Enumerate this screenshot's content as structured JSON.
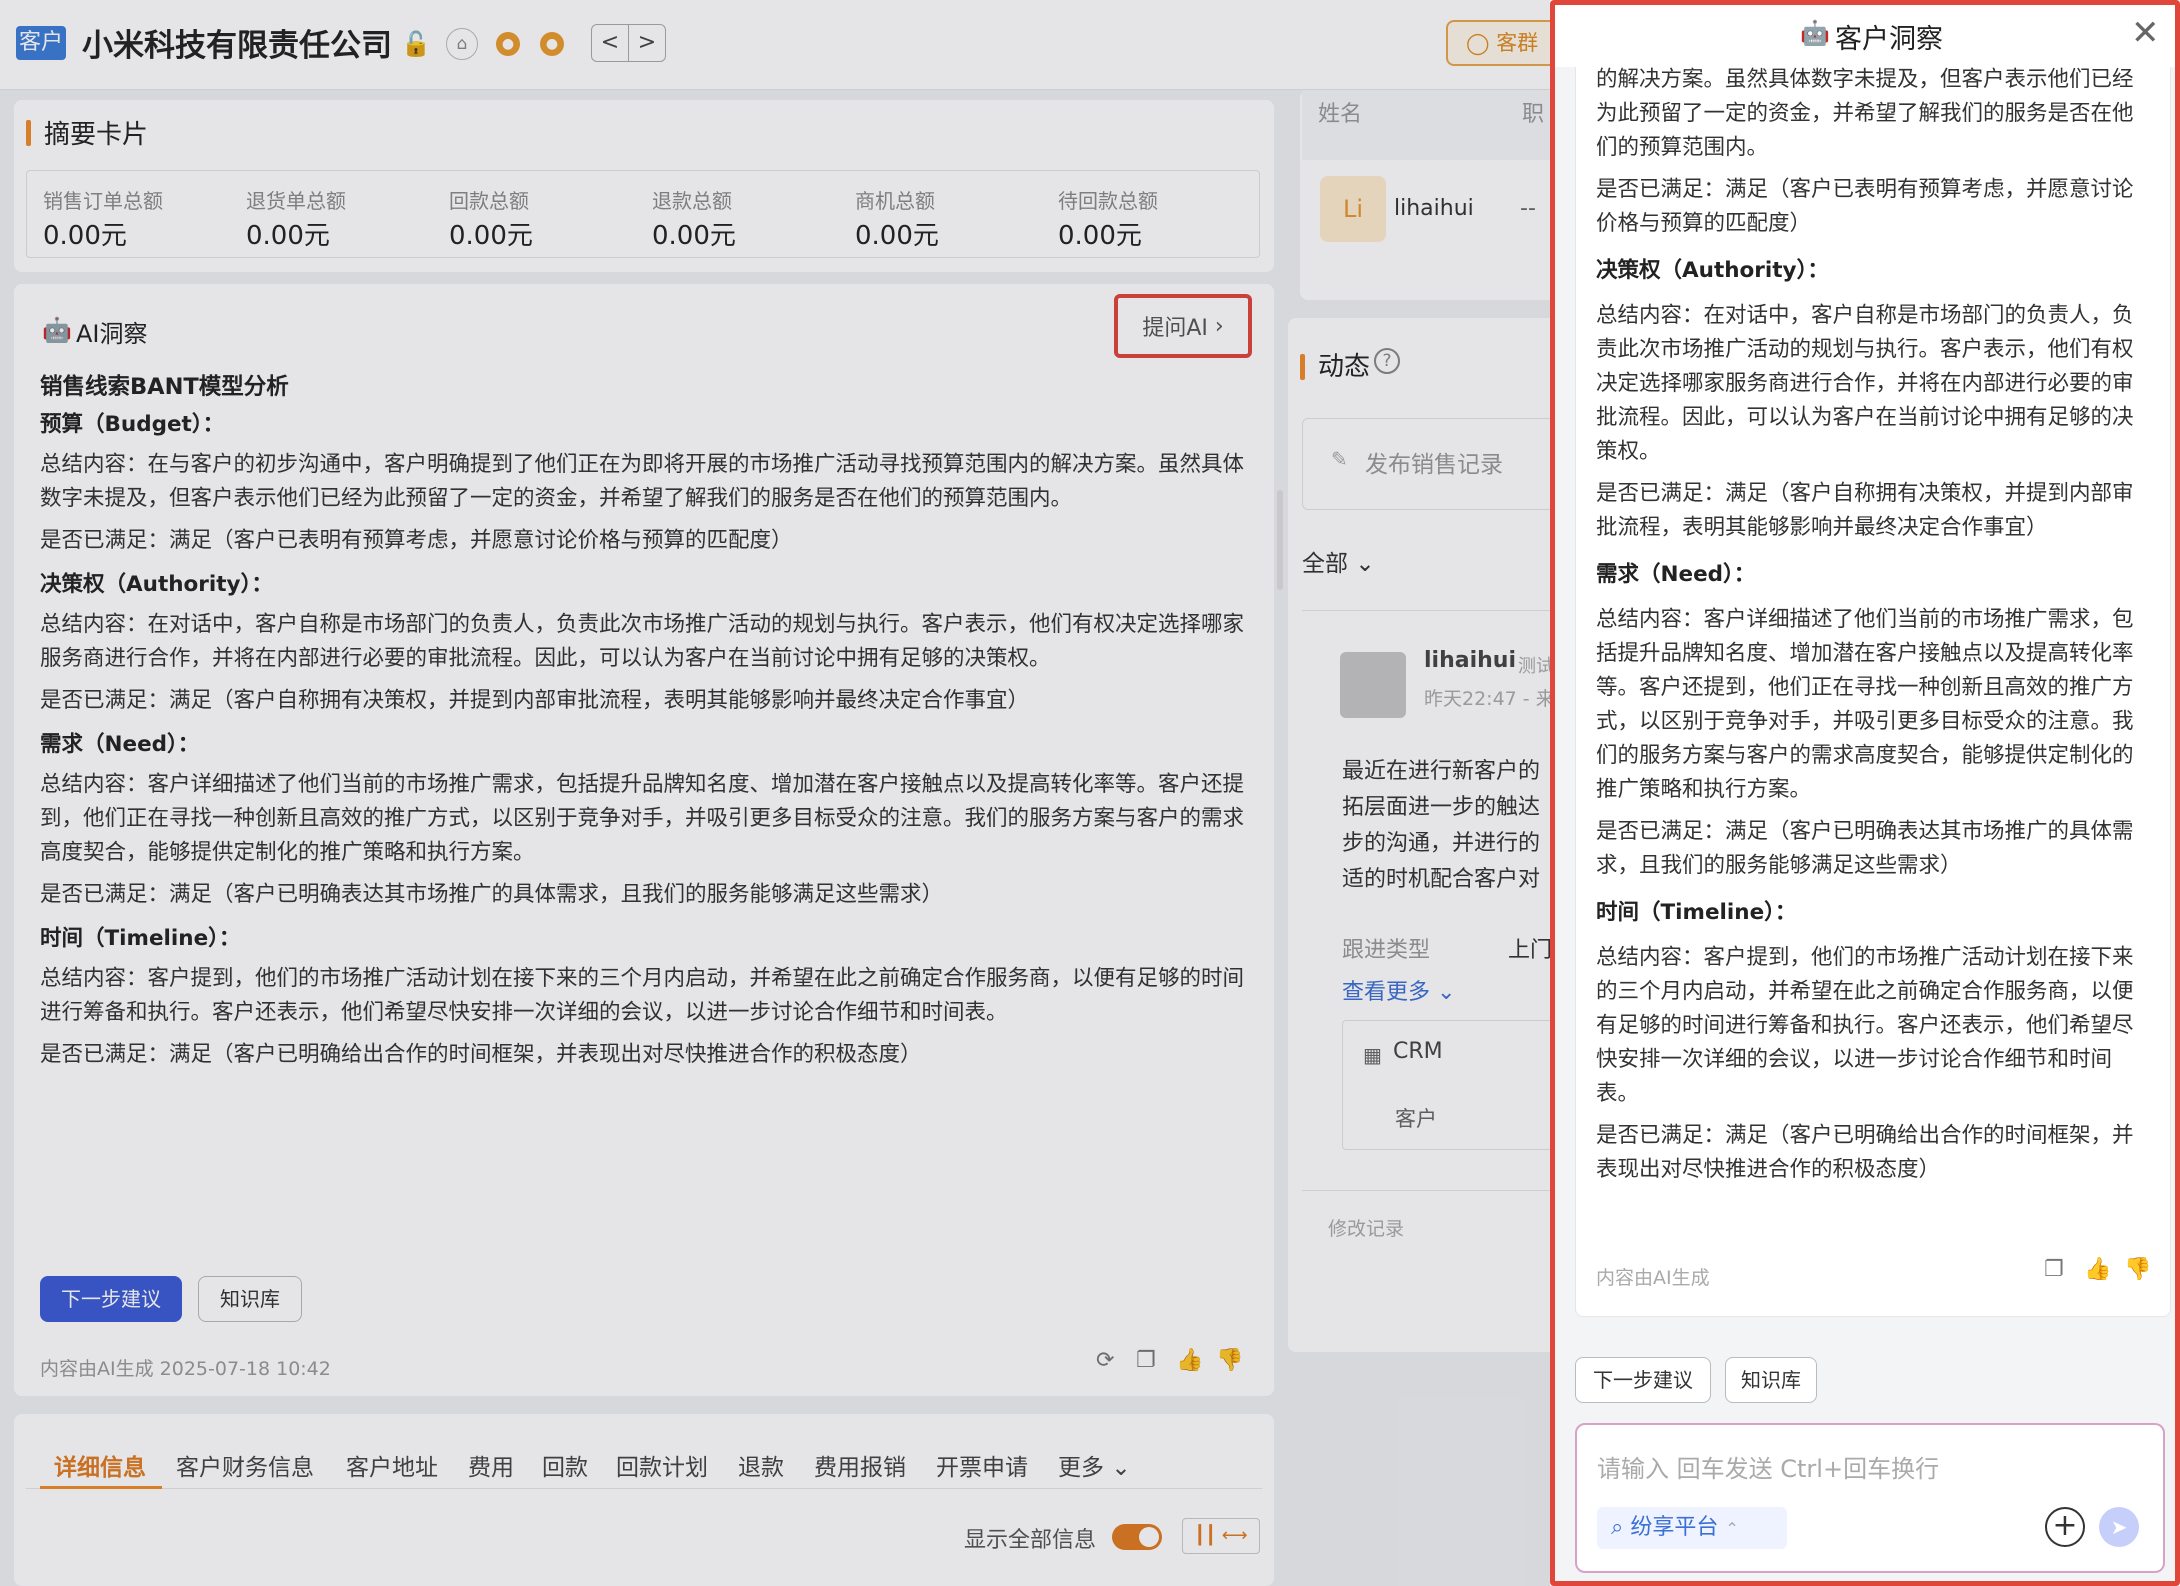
{
  "header": {
    "customer_tag": "客户",
    "company_name": "小米科技有限责任公司",
    "prev": "<",
    "next": ">",
    "chip_label": "客群"
  },
  "summary": {
    "title": "摘要卡片",
    "items": [
      {
        "label": "销售订单总额",
        "value": "0.00元"
      },
      {
        "label": "退货单总额",
        "value": "0.00元"
      },
      {
        "label": "回款总额",
        "value": "0.00元"
      },
      {
        "label": "退款总额",
        "value": "0.00元"
      },
      {
        "label": "商机总额",
        "value": "0.00元"
      },
      {
        "label": "待回款总额",
        "value": "0.00元"
      }
    ]
  },
  "ai_card": {
    "title": "AI洞察",
    "ask_ai": "提问AI",
    "analysis_title": "销售线索BANT模型分析",
    "budget_h": "预算（Budget）：",
    "budget_summary": "总结内容：在与客户的初步沟通中，客户明确提到了他们正在为即将开展的市场推广活动寻找预算范围内的解决方案。虽然具体数字未提及，但客户表示他们已经为此预留了一定的资金，并希望了解我们的服务是否在他们的预算范围内。",
    "budget_met": "是否已满足：满足（客户已表明有预算考虑，并愿意讨论价格与预算的匹配度）",
    "authority_h": "决策权（Authority）：",
    "authority_summary": "总结内容：在对话中，客户自称是市场部门的负责人，负责此次市场推广活动的规划与执行。客户表示，他们有权决定选择哪家服务商进行合作，并将在内部进行必要的审批流程。因此，可以认为客户在当前讨论中拥有足够的决策权。",
    "authority_met": "是否已满足：满足（客户自称拥有决策权，并提到内部审批流程，表明其能够影响并最终决定合作事宜）",
    "need_h": "需求（Need）：",
    "need_summary": "总结内容：客户详细描述了他们当前的市场推广需求，包括提升品牌知名度、增加潜在客户接触点以及提高转化率等。客户还提到，他们正在寻找一种创新且高效的推广方式，以区别于竞争对手，并吸引更多目标受众的注意。我们的服务方案与客户的需求高度契合，能够提供定制化的推广策略和执行方案。",
    "need_met": "是否已满足：满足（客户已明确表达其市场推广的具体需求，且我们的服务能够满足这些需求）",
    "timeline_h": "时间（Timeline）：",
    "timeline_summary": "总结内容：客户提到，他们的市场推广活动计划在接下来的三个月内启动，并希望在此之前确定合作服务商，以便有足够的时间进行筹备和执行。客户还表示，他们希望尽快安排一次详细的会议，以进一步讨论合作细节和时间表。",
    "timeline_met": "是否已满足：满足（客户已明确给出合作的时间框架，并表现出对尽快推进合作的积极态度）",
    "next_btn": "下一步建议",
    "kb_btn": "知识库",
    "footer": "内容由AI生成 2025-07-18 10:42"
  },
  "tabs": [
    "详细信息",
    "客户财务信息",
    "客户地址",
    "费用",
    "回款",
    "回款计划",
    "退款",
    "费用报销",
    "开票申请",
    "更多"
  ],
  "show_all": "显示全部信息",
  "contacts": {
    "col_name": "姓名",
    "col_pos": "职",
    "avatar": "Li",
    "name": "lihaihui",
    "pos": "--"
  },
  "feed": {
    "title": "动态",
    "post_label": "发布销售记录",
    "filter": "全部",
    "user": "lihaihui",
    "user_suffix": "测试",
    "time": "昨天22:47 - 来",
    "content_lines": [
      "最近在进行新客户的",
      "拓层面进一步的触达",
      "步的沟通，并进行的",
      "适的时机配合客户对"
    ],
    "type_label": "跟进类型",
    "type_value": "上门",
    "more": "查看更多",
    "crm": "CRM",
    "crm_item": "客户",
    "edit_log": "修改记录"
  },
  "drawer": {
    "title": "客户洞察",
    "p_budget_tail": "的解决方案。虽然具体数字未提及，但客户表示他们已经为此预留了一定的资金，并希望了解我们的服务是否在他们的预算范围内。",
    "budget_met": "是否已满足：满足（客户已表明有预算考虑，并愿意讨论价格与预算的匹配度）",
    "authority_h": "决策权（Authority）：",
    "authority_summary": "总结内容：在对话中，客户自称是市场部门的负责人，负责此次市场推广活动的规划与执行。客户表示，他们有权决定选择哪家服务商进行合作，并将在内部进行必要的审批流程。因此，可以认为客户在当前讨论中拥有足够的决策权。",
    "authority_met": "是否已满足：满足（客户自称拥有决策权，并提到内部审批流程，表明其能够影响并最终决定合作事宜）",
    "need_h": "需求（Need）：",
    "need_summary": "总结内容：客户详细描述了他们当前的市场推广需求，包括提升品牌知名度、增加潜在客户接触点以及提高转化率等。客户还提到，他们正在寻找一种创新且高效的推广方式，以区别于竞争对手，并吸引更多目标受众的注意。我们的服务方案与客户的需求高度契合，能够提供定制化的推广策略和执行方案。",
    "need_met": "是否已满足：满足（客户已明确表达其市场推广的具体需求，且我们的服务能够满足这些需求）",
    "timeline_h": "时间（Timeline）：",
    "timeline_summary": "总结内容：客户提到，他们的市场推广活动计划在接下来的三个月内启动，并希望在此之前确定合作服务商，以便有足够的时间进行筹备和执行。客户还表示，他们希望尽快安排一次详细的会议，以进一步讨论合作细节和时间表。",
    "timeline_met": "是否已满足：满足（客户已明确给出合作的时间框架，并表现出对尽快推进合作的积极态度）",
    "footer": "内容由AI生成",
    "next_btn": "下一步建议",
    "kb_btn": "知识库",
    "input_placeholder": "请输入 回车发送 Ctrl+回车换行",
    "platform": "纷享平台"
  },
  "colors": {
    "accent_orange": "#f08a2a",
    "primary_blue": "#3b5bd6",
    "highlight_red": "#e0463a"
  }
}
